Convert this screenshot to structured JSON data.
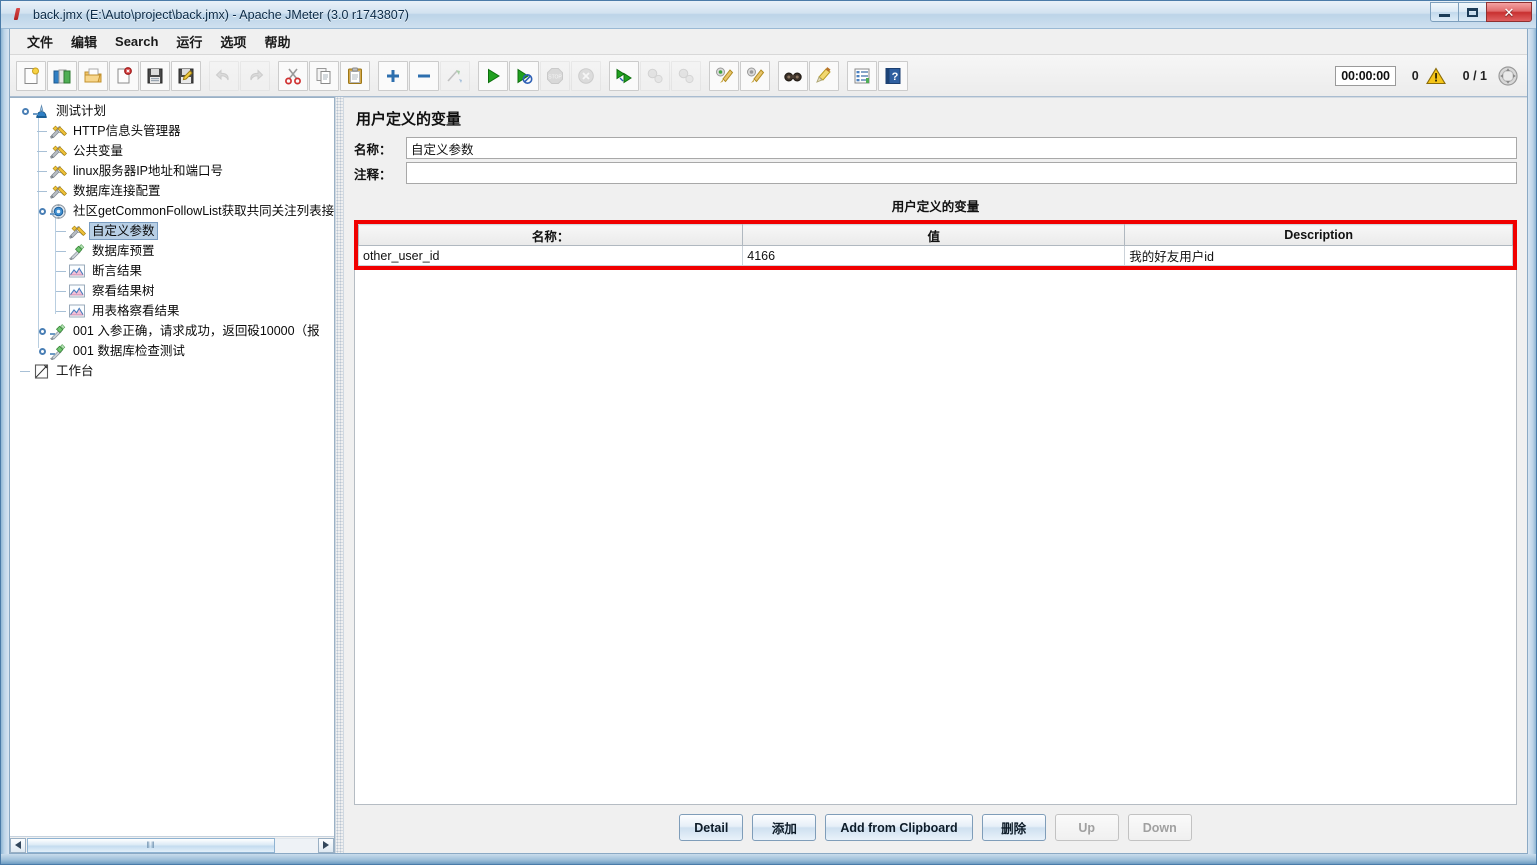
{
  "window": {
    "title": "back.jmx (E:\\Auto\\project\\back.jmx) - Apache JMeter (3.0 r1743807)",
    "icon": "jmeter-feather-icon",
    "buttons": {
      "minimize": "minimize-button",
      "maximize": "maximize-button",
      "close": "✕"
    }
  },
  "menu": {
    "items": [
      {
        "label": "文件",
        "name": "menu-file"
      },
      {
        "label": "编辑",
        "name": "menu-edit"
      },
      {
        "label": "Search",
        "name": "menu-search"
      },
      {
        "label": "运行",
        "name": "menu-run"
      },
      {
        "label": "选项",
        "name": "menu-options"
      },
      {
        "label": "帮助",
        "name": "menu-help"
      }
    ]
  },
  "toolbar": {
    "groups": [
      [
        "new-icon",
        "templates-icon",
        "open-icon",
        "close-icon",
        "save-icon",
        "save-as-icon"
      ],
      [
        "undo-icon",
        "redo-icon"
      ],
      [
        "cut-icon",
        "copy-icon",
        "paste-icon"
      ],
      [
        "expand-all-icon",
        "collapse-all-icon",
        "toggle-icon"
      ],
      [
        "start-icon",
        "start-no-pauses-icon",
        "stop-icon",
        "shutdown-icon"
      ],
      [
        "start-remote-all-icon",
        "stop-remote-all-icon",
        "shutdown-remote-all-icon"
      ],
      [
        "clear-icon",
        "clear-all-icon"
      ],
      [
        "search-icon",
        "search-reset-icon"
      ],
      [
        "function-helper-icon",
        "help-icon"
      ]
    ],
    "status": {
      "elapsed": "00:00:00",
      "warning_count": "0",
      "warning_icon": "warning-triangle-icon",
      "threads": "0 / 1",
      "remote_icon": "remote-engines-icon"
    }
  },
  "tree": {
    "nodes": [
      {
        "label": "测试计划",
        "icon": "test-plan-icon",
        "depth": 0,
        "handle": "expanded",
        "selected": false
      },
      {
        "label": "HTTP信息头管理器",
        "icon": "config-element-icon",
        "depth": 1,
        "handle": "none",
        "selected": false
      },
      {
        "label": "公共变量",
        "icon": "config-element-icon",
        "depth": 1,
        "handle": "none",
        "selected": false
      },
      {
        "label": "linux服务器IP地址和端口号",
        "icon": "config-element-icon",
        "depth": 1,
        "handle": "none",
        "selected": false
      },
      {
        "label": "数据库连接配置",
        "icon": "config-element-icon",
        "depth": 1,
        "handle": "none",
        "selected": false
      },
      {
        "label": "社区getCommonFollowList获取共同关注列表接",
        "icon": "thread-group-icon",
        "depth": 1,
        "handle": "expanded",
        "selected": false
      },
      {
        "label": "自定义参数",
        "icon": "config-element-icon",
        "depth": 2,
        "handle": "none",
        "selected": true
      },
      {
        "label": "数据库预置",
        "icon": "sampler-icon",
        "depth": 2,
        "handle": "none",
        "selected": false
      },
      {
        "label": "断言结果",
        "icon": "listener-icon",
        "depth": 2,
        "handle": "none",
        "selected": false
      },
      {
        "label": "察看结果树",
        "icon": "listener-icon",
        "depth": 2,
        "handle": "none",
        "selected": false
      },
      {
        "label": "用表格察看结果",
        "icon": "listener-icon",
        "depth": 2,
        "handle": "none",
        "selected": false
      },
      {
        "label": "001 入参正确，请求成功，返回砓10000（报",
        "icon": "sampler-icon",
        "depth": 1,
        "handle": "collapsed",
        "selected": false
      },
      {
        "label": "001 数据库检查测试",
        "icon": "sampler-icon",
        "depth": 1,
        "handle": "collapsed",
        "selected": false
      },
      {
        "label": "工作台",
        "icon": "workbench-icon",
        "depth": 0,
        "handle": "none",
        "selected": false
      }
    ],
    "hscrollbar": {
      "left_arrow": "scroll-left-icon",
      "right_arrow": "scroll-right-icon",
      "grip": "‖‖"
    }
  },
  "main": {
    "panel_title": "用户定义的变量",
    "fields": [
      {
        "label": "名称：",
        "value": "自定义参数",
        "name": "name-field"
      },
      {
        "label": "注释：",
        "value": "",
        "name": "comment-field"
      }
    ],
    "section_title": "用户定义的变量",
    "table": {
      "highlight_color": "#f00000",
      "columns": [
        "名称：",
        "值",
        "Description"
      ],
      "rows": [
        [
          "other_user_id",
          "4166",
          "我的好友用户id"
        ]
      ]
    },
    "buttons": [
      {
        "label": "Detail",
        "name": "detail-button",
        "enabled": true
      },
      {
        "label": "添加",
        "name": "add-button",
        "enabled": true
      },
      {
        "label": "Add from Clipboard",
        "name": "add-from-clipboard-button",
        "enabled": true
      },
      {
        "label": "删除",
        "name": "delete-button",
        "enabled": true
      },
      {
        "label": "Up",
        "name": "up-button",
        "enabled": false
      },
      {
        "label": "Down",
        "name": "down-button",
        "enabled": false
      }
    ]
  }
}
